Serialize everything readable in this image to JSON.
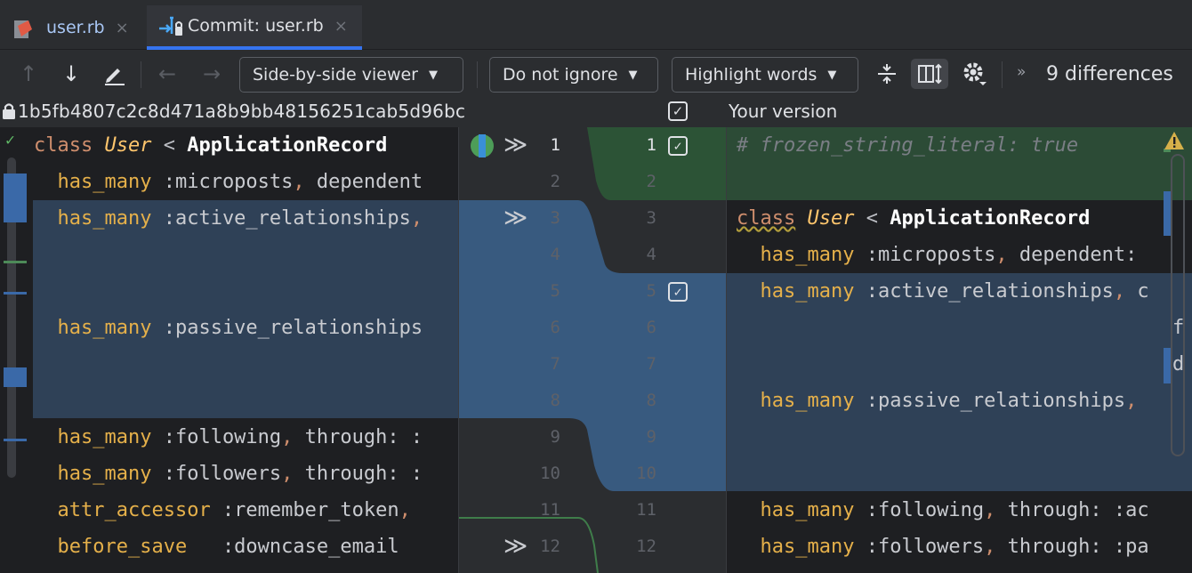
{
  "tabs": [
    {
      "label": "user.rb",
      "close": "×"
    },
    {
      "label": "Commit: user.rb",
      "close": "×"
    }
  ],
  "toolbar": {
    "viewer": "Side-by-side viewer",
    "ignore": "Do not ignore",
    "highlight": "Highlight words",
    "caret": "▼",
    "chevrons": "»",
    "differences": "9 differences"
  },
  "header": {
    "hash": "1b5fb4807c2c8d471a8b9bb48156251cab5d96bc",
    "your_version": "Your version"
  },
  "left_lines": [
    "class User < ApplicationRecord",
    "  has_many :microposts, dependent",
    "  has_many :active_relationships,",
    "",
    "",
    "  has_many :passive_relationships",
    "",
    "",
    "  has_many :following, through: :",
    "  has_many :followers, through: :",
    "  attr_accessor :remember_token,",
    "  before_save   :downcase_email"
  ],
  "right_lines": [
    "# frozen_string_literal: true",
    "",
    "class User < ApplicationRecord",
    "  has_many :microposts, dependent:",
    "  has_many :active_relationships, c",
    "",
    "",
    "  has_many :passive_relationships,",
    "",
    "",
    "  has_many :following, through: :ac",
    "  has_many :followers, through: :pa"
  ],
  "line_numbers": [
    "1",
    "2",
    "3",
    "4",
    "5",
    "6",
    "7",
    "8",
    "9",
    "10",
    "11",
    "12"
  ],
  "icons": [
    "ruby-file-icon",
    "merge-icon",
    "up-arrow-icon",
    "down-arrow-icon",
    "edit-icon",
    "back-arrow-icon",
    "forward-arrow-icon",
    "collapse-icon",
    "columns-icon",
    "gear-icon",
    "lock-icon",
    "apply-chevrons-icon",
    "checkbox-icon",
    "warning-icon"
  ],
  "colors": {
    "accent": "#3574f0",
    "changed_bg": "#2f4157",
    "inserted_bg": "#2c4b36",
    "connector_changed": "#385a7f",
    "connector_inserted": "#2d5a37"
  }
}
